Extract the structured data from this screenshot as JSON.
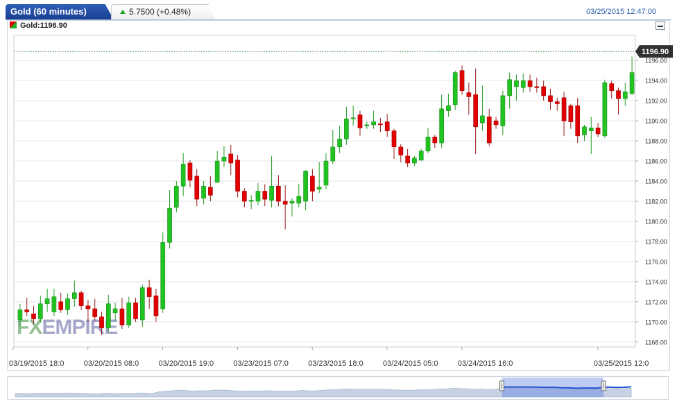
{
  "header": {
    "title": "Gold (60 minutes)",
    "change": "5.7500 (+0.48%)",
    "timestamp": "03/25/2015 12:47:00"
  },
  "legend": {
    "label": "Gold:1196.90"
  },
  "watermark": "FXEMPIRE",
  "colors": {
    "up": "#21c321",
    "down": "#e00000",
    "accent": "#1f4fa8",
    "grid": "#e3e6ea"
  },
  "chart_data": {
    "type": "candlestick",
    "title": "Gold (60 minutes)",
    "series_name": "Gold",
    "last_price": 1196.9,
    "last_price_label": "1196.90",
    "ylim": [
      1167.5,
      1198.5
    ],
    "y_ticks": [
      "1168.00",
      "1170.00",
      "1172.00",
      "1174.00",
      "1176.00",
      "1178.00",
      "1180.00",
      "1182.00",
      "1184.00",
      "1186.00",
      "1188.00",
      "1190.00",
      "1192.00",
      "1194.00",
      "1196.00"
    ],
    "x_tick_labels": [
      "03/19/2015 18:0",
      "03/20/2015 08:0",
      "03/20/2015 19:0",
      "03/23/2015 07:0",
      "03/23/2015 18:0",
      "03/24/2015 05:0",
      "03/24/2015 16:0",
      "03/25/2015 12:0"
    ],
    "x_tick_index": [
      0,
      11,
      22,
      33,
      44,
      55,
      66,
      86
    ],
    "grid": true,
    "candles": [
      [
        1170.2,
        1171.2,
        1169.6,
        1171.8
      ],
      [
        1171.2,
        1171.0,
        1170.6,
        1172.4
      ],
      [
        1170.8,
        1170.3,
        1169.8,
        1171.6
      ],
      [
        1170.3,
        1171.8,
        1169.9,
        1172.6
      ],
      [
        1171.8,
        1172.3,
        1171.0,
        1173.3
      ],
      [
        1171.0,
        1172.5,
        1170.6,
        1173.3
      ],
      [
        1172.0,
        1171.2,
        1170.9,
        1172.9
      ],
      [
        1171.2,
        1172.3,
        1170.7,
        1172.8
      ],
      [
        1172.3,
        1172.9,
        1171.5,
        1174.1
      ],
      [
        1172.9,
        1171.6,
        1171.2,
        1173.1
      ],
      [
        1171.6,
        1171.3,
        1170.0,
        1172.2
      ],
      [
        1171.3,
        1170.5,
        1170.1,
        1172.3
      ],
      [
        1170.5,
        1169.4,
        1168.7,
        1171.0
      ],
      [
        1169.4,
        1171.8,
        1169.0,
        1172.7
      ],
      [
        1170.9,
        1171.3,
        1170.1,
        1171.9
      ],
      [
        1171.3,
        1169.7,
        1169.3,
        1172.4
      ],
      [
        1169.7,
        1171.9,
        1169.4,
        1172.5
      ],
      [
        1171.9,
        1170.3,
        1170.0,
        1172.4
      ],
      [
        1170.2,
        1173.4,
        1169.5,
        1173.7
      ],
      [
        1173.4,
        1172.5,
        1171.3,
        1174.2
      ],
      [
        1172.6,
        1170.6,
        1170.0,
        1173.3
      ],
      [
        1171.3,
        1177.9,
        1170.9,
        1178.9
      ],
      [
        1177.9,
        1181.3,
        1177.3,
        1183.1
      ],
      [
        1181.4,
        1183.5,
        1180.9,
        1184.0
      ],
      [
        1183.5,
        1185.7,
        1182.5,
        1186.8
      ],
      [
        1185.8,
        1184.1,
        1183.4,
        1186.1
      ],
      [
        1184.5,
        1182.2,
        1181.5,
        1185.2
      ],
      [
        1182.3,
        1183.5,
        1181.7,
        1184.0
      ],
      [
        1183.4,
        1182.6,
        1182.0,
        1184.5
      ],
      [
        1183.9,
        1186.0,
        1183.8,
        1187.0
      ],
      [
        1186.0,
        1186.4,
        1185.4,
        1187.5
      ],
      [
        1186.7,
        1185.8,
        1184.6,
        1187.6
      ],
      [
        1186.1,
        1183.0,
        1182.4,
        1186.6
      ],
      [
        1183.0,
        1182.0,
        1181.4,
        1183.3
      ],
      [
        1182.0,
        1182.1,
        1181.2,
        1182.6
      ],
      [
        1182.0,
        1183.0,
        1181.6,
        1183.8
      ],
      [
        1183.0,
        1182.2,
        1181.5,
        1183.7
      ],
      [
        1182.1,
        1183.5,
        1181.4,
        1186.5
      ],
      [
        1183.5,
        1182.0,
        1181.5,
        1184.6
      ],
      [
        1182.0,
        1181.7,
        1179.2,
        1183.6
      ],
      [
        1181.8,
        1182.0,
        1180.5,
        1182.3
      ],
      [
        1181.8,
        1182.5,
        1181.4,
        1183.7
      ],
      [
        1182.0,
        1185.0,
        1181.1,
        1185.1
      ],
      [
        1184.5,
        1183.0,
        1182.0,
        1185.2
      ],
      [
        1183.2,
        1183.4,
        1182.8,
        1185.9
      ],
      [
        1183.6,
        1186.0,
        1183.2,
        1186.8
      ],
      [
        1186.0,
        1187.4,
        1185.7,
        1189.1
      ],
      [
        1187.4,
        1188.2,
        1186.8,
        1189.5
      ],
      [
        1188.2,
        1190.2,
        1187.6,
        1191.4
      ],
      [
        1190.2,
        1190.3,
        1189.5,
        1191.5
      ],
      [
        1190.6,
        1189.3,
        1188.5,
        1191.0
      ],
      [
        1189.5,
        1189.6,
        1189.2,
        1189.9
      ],
      [
        1189.6,
        1189.9,
        1189.2,
        1191.0
      ],
      [
        1189.7,
        1189.6,
        1188.9,
        1190.3
      ],
      [
        1189.9,
        1189.0,
        1188.4,
        1190.7
      ],
      [
        1189.0,
        1187.4,
        1186.2,
        1189.2
      ],
      [
        1187.4,
        1186.6,
        1185.9,
        1187.7
      ],
      [
        1186.5,
        1185.8,
        1185.4,
        1187.2
      ],
      [
        1185.8,
        1186.3,
        1185.5,
        1186.5
      ],
      [
        1186.1,
        1187.0,
        1186.0,
        1187.2
      ],
      [
        1187.0,
        1188.4,
        1186.8,
        1189.3
      ],
      [
        1188.4,
        1187.8,
        1187.3,
        1188.6
      ],
      [
        1187.8,
        1191.2,
        1187.3,
        1192.6
      ],
      [
        1191.0,
        1191.5,
        1190.4,
        1192.7
      ],
      [
        1191.6,
        1194.8,
        1191.1,
        1195.0
      ],
      [
        1195.0,
        1193.0,
        1192.6,
        1195.5
      ],
      [
        1192.8,
        1192.4,
        1190.6,
        1193.8
      ],
      [
        1192.6,
        1189.4,
        1186.7,
        1195.2
      ],
      [
        1189.8,
        1190.5,
        1189.0,
        1193.5
      ],
      [
        1190.4,
        1187.8,
        1187.5,
        1191.2
      ],
      [
        1190.0,
        1189.6,
        1189.2,
        1190.4
      ],
      [
        1189.5,
        1192.5,
        1188.6,
        1193.0
      ],
      [
        1192.5,
        1194.1,
        1191.2,
        1194.8
      ],
      [
        1193.4,
        1194.0,
        1192.0,
        1194.6
      ],
      [
        1193.3,
        1194.0,
        1192.8,
        1194.7
      ],
      [
        1194.0,
        1193.4,
        1192.9,
        1194.6
      ],
      [
        1193.4,
        1193.3,
        1192.8,
        1194.3
      ],
      [
        1193.4,
        1192.5,
        1192.0,
        1194.0
      ],
      [
        1192.5,
        1191.9,
        1191.1,
        1193.2
      ],
      [
        1191.9,
        1191.7,
        1191.0,
        1192.3
      ],
      [
        1192.3,
        1190.0,
        1188.5,
        1192.9
      ],
      [
        1191.5,
        1189.9,
        1189.2,
        1191.7
      ],
      [
        1191.5,
        1188.5,
        1187.8,
        1192.3
      ],
      [
        1188.6,
        1189.4,
        1188.0,
        1189.6
      ],
      [
        1189.0,
        1189.3,
        1186.7,
        1190.4
      ],
      [
        1189.3,
        1188.7,
        1188.4,
        1189.8
      ],
      [
        1188.5,
        1193.8,
        1188.3,
        1194.1
      ],
      [
        1193.7,
        1193.0,
        1192.2,
        1194.0
      ],
      [
        1193.0,
        1192.2,
        1190.6,
        1193.3
      ],
      [
        1192.2,
        1192.9,
        1191.5,
        1193.8
      ],
      [
        1192.7,
        1194.8,
        1192.6,
        1196.4
      ]
    ]
  },
  "navigator": {
    "handle_start_fraction": 0.79,
    "handle_end_fraction": 0.955
  }
}
